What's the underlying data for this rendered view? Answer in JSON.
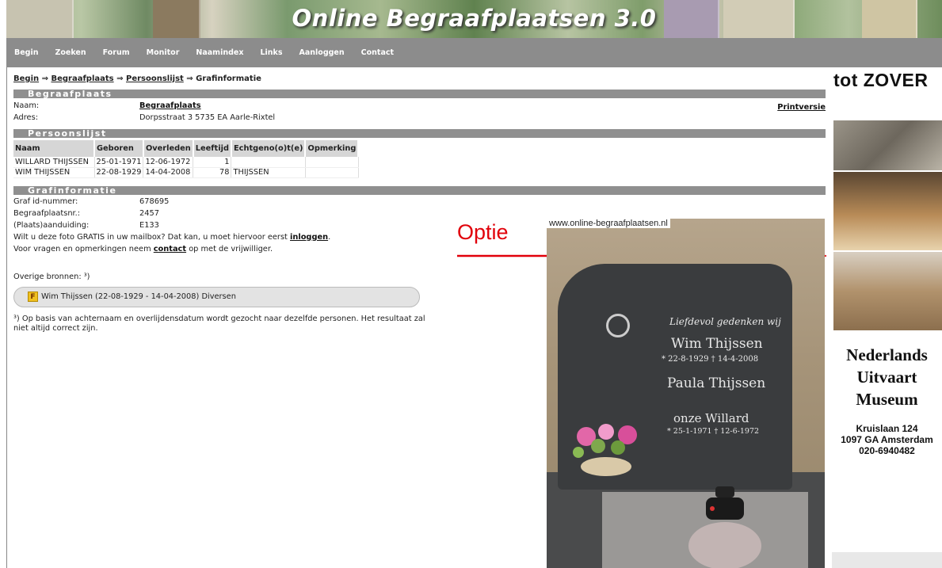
{
  "banner": {
    "title": "Online Begraafplaatsen 3.0"
  },
  "nav": [
    "Begin",
    "Zoeken",
    "Forum",
    "Monitor",
    "Naamindex",
    "Links",
    "Aanloggen",
    "Contact"
  ],
  "breadcrumb": {
    "items": [
      "Begin",
      "Begraafplaats",
      "Persoonslijst"
    ],
    "current": "Grafinformatie",
    "separator": "⇒"
  },
  "begraafplaats": {
    "section_title": "Begraafplaats",
    "naam_label": "Naam:",
    "naam_value": "Begraafplaats",
    "adres_label": "Adres:",
    "adres_value": "Dorpsstraat 3 5735 EA Aarle-Rixtel",
    "print_link": "Printversie"
  },
  "persoonslijst": {
    "section_title": "Persoonslijst",
    "columns": [
      "Naam",
      "Geboren",
      "Overleden",
      "Leeftijd",
      "Echtgeno(o)t(e)",
      "Opmerking"
    ],
    "rows": [
      [
        "WILLARD THIJSSEN",
        "25-01-1971",
        "12-06-1972",
        "1",
        "",
        ""
      ],
      [
        "WIM THIJSSEN",
        "22-08-1929",
        "14-04-2008",
        "78",
        "THIJSSEN",
        ""
      ]
    ]
  },
  "grafinformatie": {
    "section_title": "Grafinformatie",
    "fields": [
      {
        "label": "Graf id-nummer:",
        "value": "678695"
      },
      {
        "label": "Begraafplaatsnr.:",
        "value": "2457"
      },
      {
        "label": "(Plaats)aanduiding:",
        "value": "E133"
      }
    ],
    "mail_text": "Wilt u deze foto GRATIS in uw mailbox? Dat kan, u moet hiervoor eerst",
    "mail_link": "inloggen",
    "contact_pre": "Voor vragen en opmerkingen neem",
    "contact_link": "contact",
    "contact_post": "op met de vrijwilliger.",
    "other_sources_label": "Overige bronnen: ³)",
    "source_item": "Wim Thijssen (22-08-1929 - 14-04-2008) Diversen",
    "source_icon": "F",
    "footnote": "³) Op basis van achternaam en overlijdensdatum wordt gezocht naar dezelfde personen. Het resultaat zal niet altijd correct zijn."
  },
  "photo": {
    "watermark": "www.online-begraafplaatsen.nl",
    "inscription": [
      "Liefdevol gedenken wij",
      "Wim Thijssen",
      "* 22-8-1929   † 14-4-2008",
      "Paula Thijssen",
      "onze Willard",
      "* 25-1-1971   † 12-6-1972"
    ]
  },
  "annotation": {
    "label": "Optie",
    "color": "#e1000a"
  },
  "ad": {
    "title": "tot ZOVER",
    "museum": [
      "Nederlands",
      "Uitvaart",
      "Museum"
    ],
    "address": [
      "Kruislaan 124",
      "1097 GA Amsterdam",
      "020-6940482"
    ]
  }
}
